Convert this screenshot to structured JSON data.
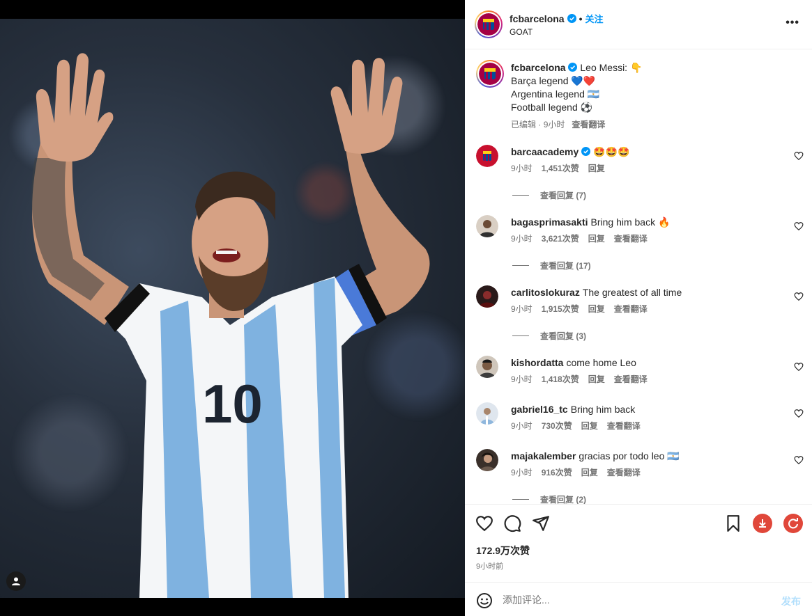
{
  "header": {
    "username": "fcbarcelona",
    "dot": "•",
    "follow_label": "关注",
    "subtitle": "GOAT",
    "more_label": "•••"
  },
  "caption": {
    "username": "fcbarcelona",
    "lines": [
      "Leo Messi: 👇",
      "Barça legend 💙❤️",
      "Argentina legend 🇦🇷",
      "Football legend ⚽"
    ],
    "edited": "已编辑",
    "time": "9小时",
    "translate": "查看翻译"
  },
  "comments": [
    {
      "user": "barcaacademy",
      "text": "🤩🤩🤩",
      "time": "9小时",
      "likes": "1,451次赞",
      "reply": "回复",
      "translate": "",
      "replies": "查看回复 (7)"
    },
    {
      "user": "bagasprimasakti",
      "text": "Bring him back 🔥",
      "time": "9小时",
      "likes": "3,621次赞",
      "reply": "回复",
      "translate": "查看翻译",
      "replies": "查看回复 (17)"
    },
    {
      "user": "carlitoslokuraz",
      "text": "The greatest of all time",
      "time": "9小时",
      "likes": "1,915次赞",
      "reply": "回复",
      "translate": "查看翻译",
      "replies": "查看回复 (3)"
    },
    {
      "user": "kishordatta",
      "text": "come home Leo",
      "time": "9小时",
      "likes": "1,418次赞",
      "reply": "回复",
      "translate": "查看翻译",
      "replies": ""
    },
    {
      "user": "gabriel16_tc",
      "text": "Bring him back",
      "time": "9小时",
      "likes": "730次赞",
      "reply": "回复",
      "translate": "查看翻译",
      "replies": ""
    },
    {
      "user": "majakalember",
      "text": "gracias por todo leo 🇦🇷",
      "time": "9小时",
      "likes": "916次赞",
      "reply": "回复",
      "translate": "查看翻译",
      "replies": "查看回复 (2)"
    }
  ],
  "actions": {
    "likes": "172.9万次赞",
    "time": "9小时前"
  },
  "add_comment": {
    "placeholder": "添加评论...",
    "post_label": "发布"
  },
  "colors": {
    "accent": "#0095f6",
    "verified": "#0095f6",
    "download_ext": "#e0473a",
    "refresh_ext": "#e0473a"
  },
  "icons": [
    "user-tag-icon",
    "verified-icon",
    "more-icon",
    "heart-icon",
    "comment-icon",
    "share-icon",
    "bookmark-icon",
    "download-icon",
    "refresh-icon",
    "emoji-icon"
  ]
}
